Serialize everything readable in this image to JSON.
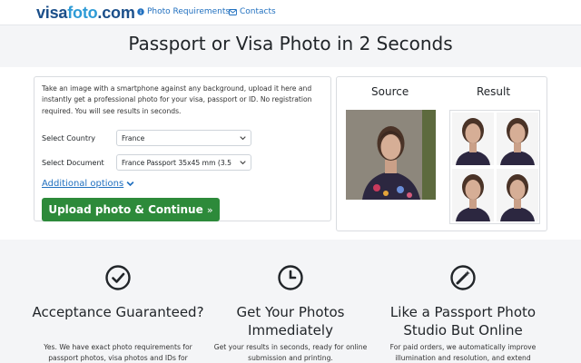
{
  "navbar": {
    "logo_visa": "visa",
    "logo_foto": "foto",
    "logo_com": ".com",
    "requirements_label": "Photo Requirements",
    "contacts_label": "Contacts",
    "info_icon": "info-circle-icon",
    "envelope_icon": "envelope-icon"
  },
  "hero": {
    "title": "Passport or Visa Photo in 2 Seconds"
  },
  "form": {
    "intro": "Take an image with a smartphone against any background, upload it here and instantly get a professional photo for your visa, passport or ID. No registration required. You will see results in seconds.",
    "country_label": "Select Country",
    "country_value": "France",
    "document_label": "Select Document",
    "document_value": "France Passport 35x45 mm (3.5",
    "additional_options": "Additional options",
    "upload_button": "Upload photo & Continue",
    "upload_chevron": "»"
  },
  "preview": {
    "source_label": "Source",
    "result_label": "Result"
  },
  "features": [
    {
      "icon": "check-circle-icon",
      "title": "Acceptance Guaranteed?",
      "text": "Yes. We have exact photo requirements for passport photos, visa photos and IDs for"
    },
    {
      "icon": "clock-icon",
      "title": "Get Your Photos Immediately",
      "text": "Get your results in seconds, ready for online submission and printing."
    },
    {
      "icon": "magic-wand-icon",
      "title": "Like a Passport Photo Studio But Online",
      "text": "For paid orders, we automatically improve illumination and resolution, and extend"
    }
  ],
  "colors": {
    "brand_dark": "#1b4f8a",
    "brand_light": "#2e9bd6",
    "link": "#1f6fbf",
    "upload_button": "#2d8a3a"
  }
}
